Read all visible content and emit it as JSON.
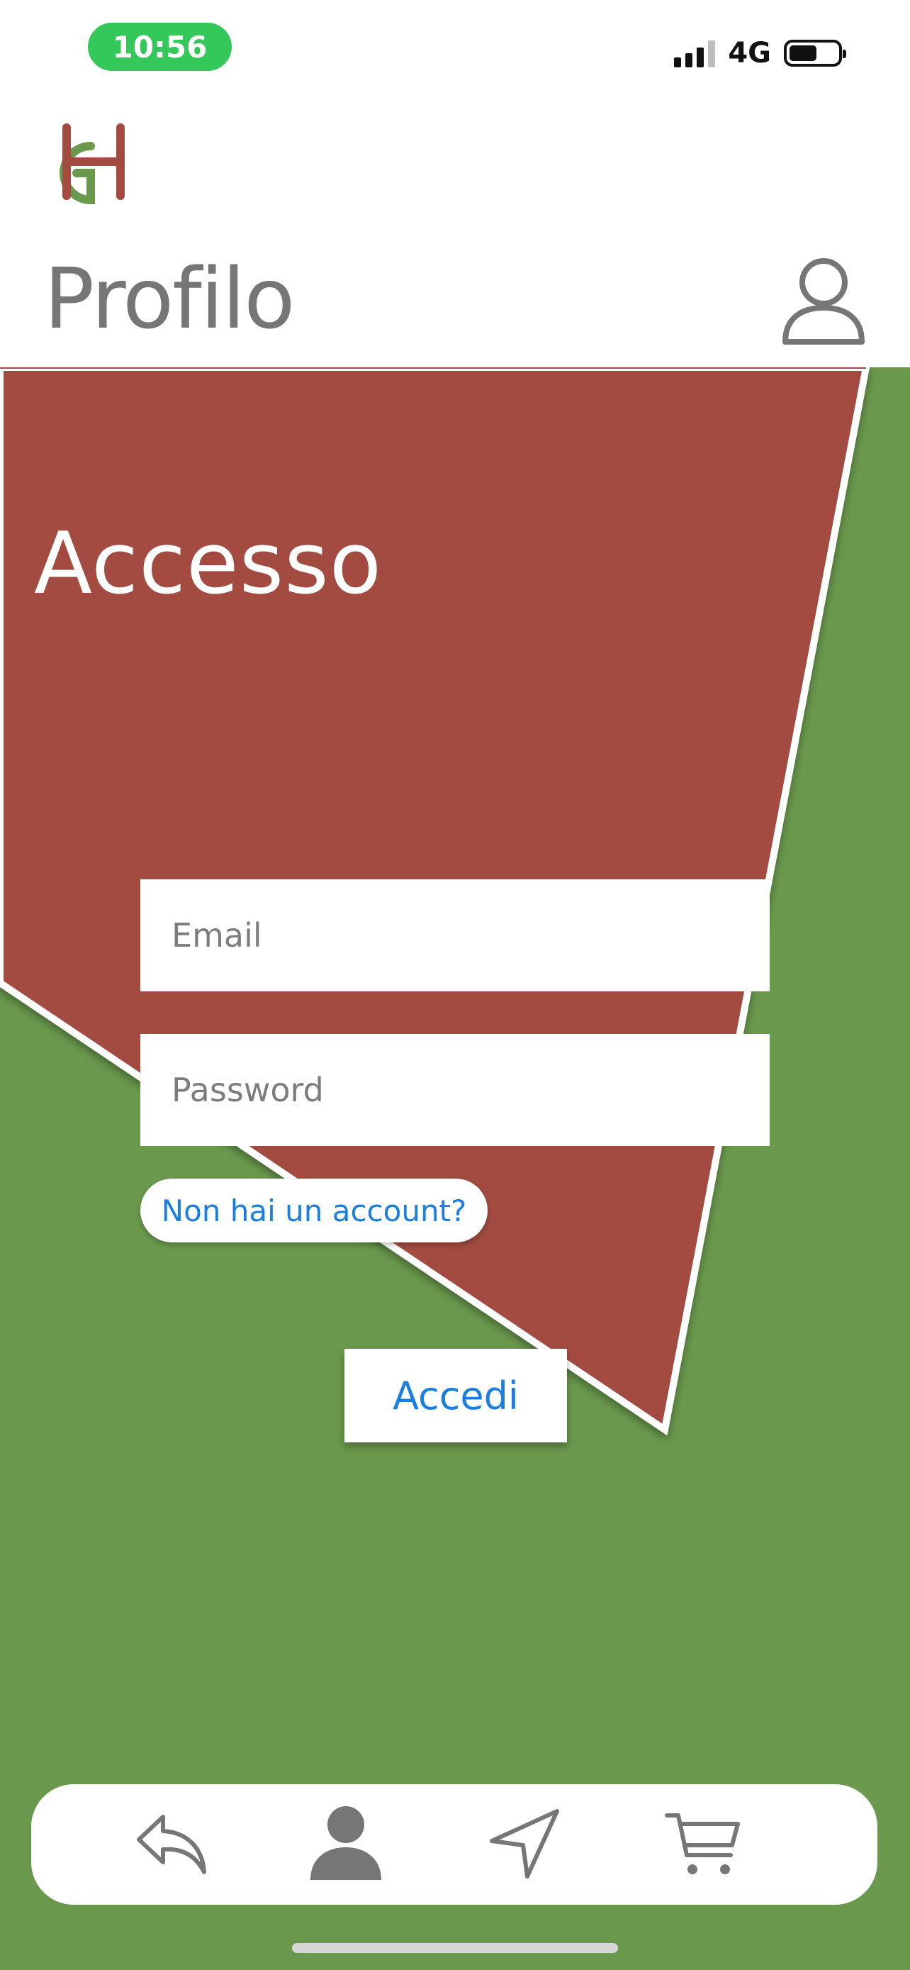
{
  "status_bar": {
    "time": "10:56",
    "network": "4G",
    "battery_level": 0.55
  },
  "header": {
    "title": "Profilo",
    "logo_text": "GH"
  },
  "login": {
    "title": "Accesso",
    "email_placeholder": "Email",
    "password_placeholder": "Password",
    "signup_link": "Non hai un account?",
    "submit_label": "Accedi"
  },
  "tab_bar": {
    "items": [
      {
        "icon": "back-arrow-icon",
        "active": false
      },
      {
        "icon": "person-icon",
        "active": true
      },
      {
        "icon": "navigation-icon",
        "active": false
      },
      {
        "icon": "cart-icon",
        "active": false
      }
    ]
  },
  "colors": {
    "brand_green": "#6a994d",
    "brand_red": "#a34b40",
    "status_green": "#34c759",
    "link_blue": "#1a7fe0",
    "icon_gray": "#767676"
  }
}
